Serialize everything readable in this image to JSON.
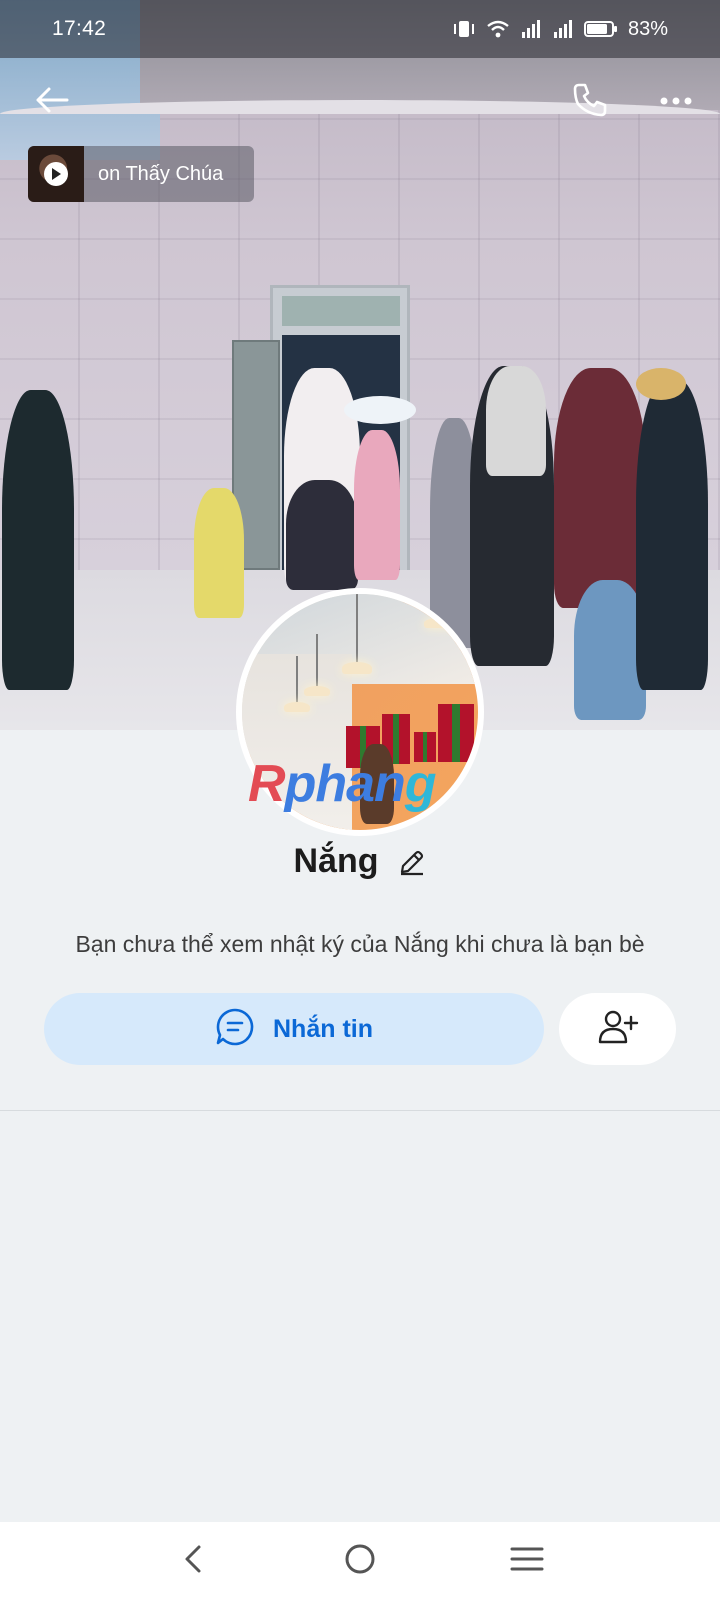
{
  "status_bar": {
    "time": "17:42",
    "battery": "83%",
    "icons": [
      "vibrate-icon",
      "wifi-icon",
      "signal-icon",
      "signal-icon",
      "battery-icon"
    ]
  },
  "header": {
    "icons": [
      "back-arrow-icon",
      "phone-icon",
      "more-icon"
    ]
  },
  "music": {
    "title": "on Thấy Chúa",
    "icon": "play-icon"
  },
  "profile": {
    "name": "Nắng",
    "edit_icon": "pencil-icon",
    "notice": "Bạn chưa thể xem nhật ký của Nắng khi chưa là bạn bè",
    "watermark": {
      "part1": "R",
      "part2": "phan",
      "part3": "g"
    }
  },
  "actions": {
    "message_label": "Nhắn tin",
    "message_icon": "chat-bubble-icon",
    "add_friend_icon": "add-friend-icon",
    "accent_color": "#0b68d6",
    "message_bg": "#d6e9fb"
  },
  "system_nav": {
    "icons": [
      "nav-back-icon",
      "nav-home-icon",
      "nav-menu-icon"
    ]
  }
}
